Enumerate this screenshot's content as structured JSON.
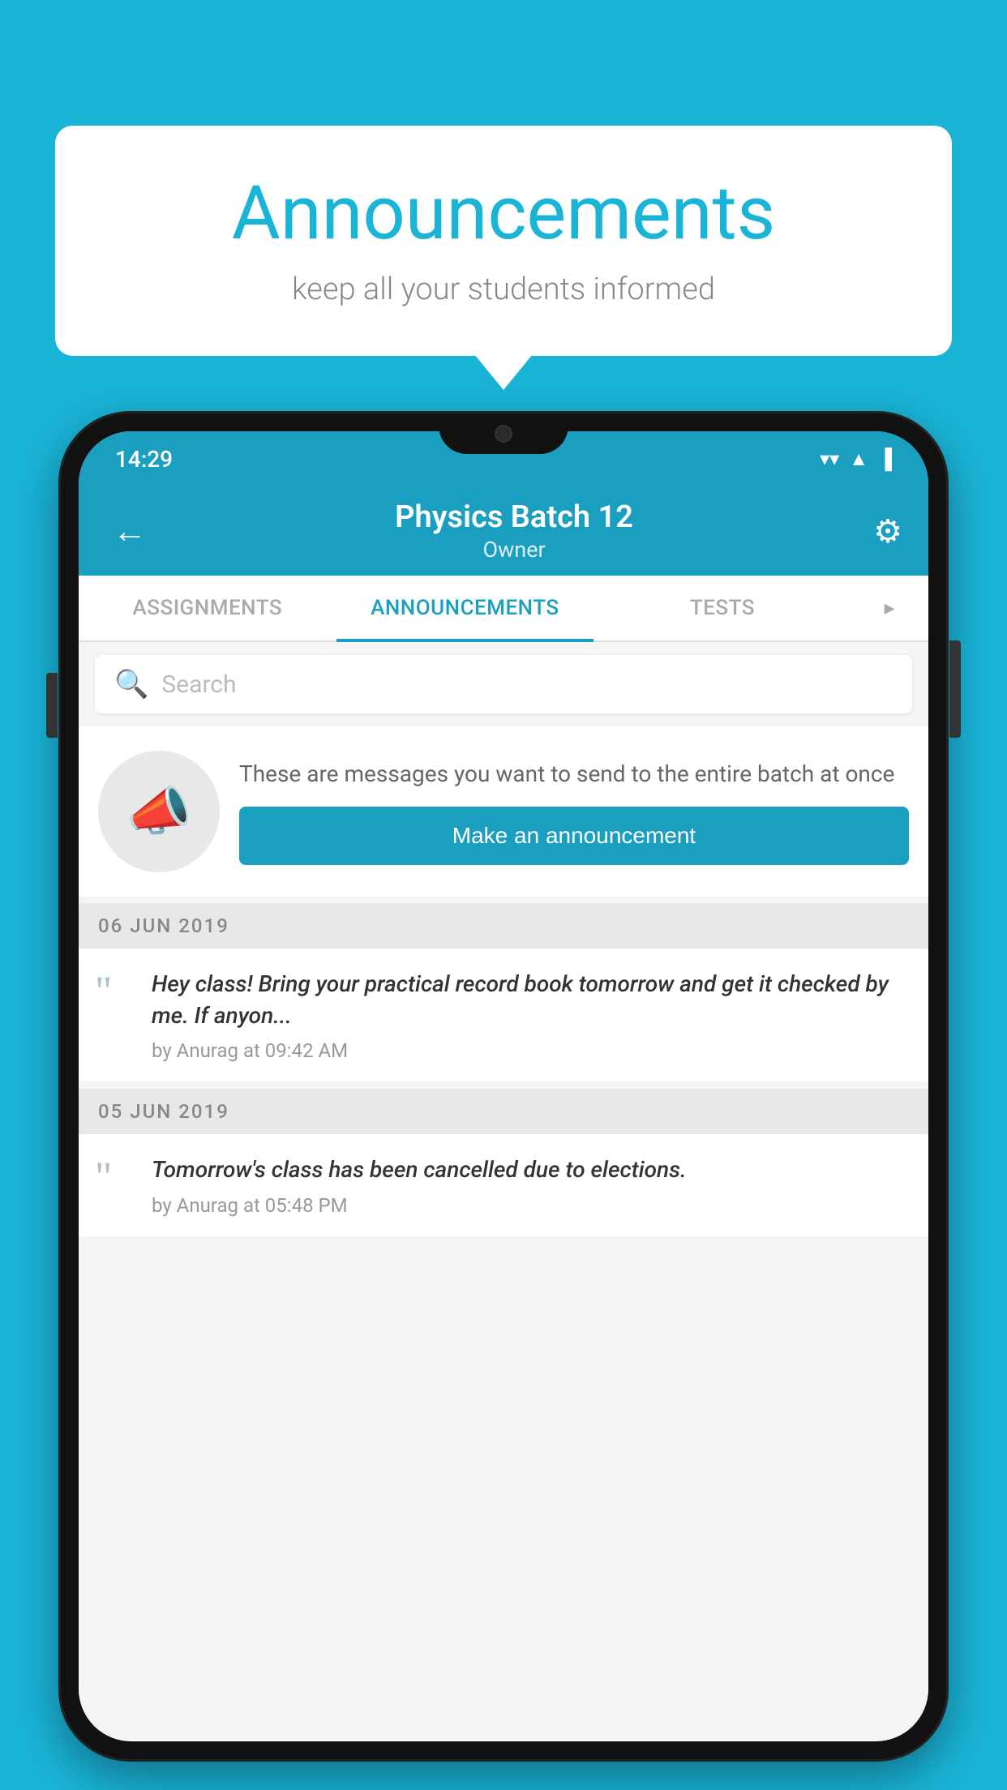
{
  "page": {
    "background_color": "#1ab4d7"
  },
  "speech_bubble": {
    "title": "Announcements",
    "subtitle": "keep all your students informed"
  },
  "status_bar": {
    "time": "14:29",
    "icons": [
      "wifi",
      "signal",
      "battery"
    ]
  },
  "toolbar": {
    "title": "Physics Batch 12",
    "subtitle": "Owner",
    "back_label": "←",
    "gear_label": "⚙"
  },
  "tabs": [
    {
      "label": "ASSIGNMENTS",
      "active": false
    },
    {
      "label": "ANNOUNCEMENTS",
      "active": true
    },
    {
      "label": "TESTS",
      "active": false
    },
    {
      "label": "...",
      "active": false
    }
  ],
  "search": {
    "placeholder": "Search"
  },
  "promo": {
    "description": "These are messages you want to send to the entire batch at once",
    "button_label": "Make an announcement"
  },
  "announcements": [
    {
      "date": "06  JUN  2019",
      "text": "Hey class! Bring your practical record book tomorrow and get it checked by me. If anyon...",
      "meta": "by Anurag at 09:42 AM"
    },
    {
      "date": "05  JUN  2019",
      "text": "Tomorrow's class has been cancelled due to elections.",
      "meta": "by Anurag at 05:48 PM"
    }
  ]
}
